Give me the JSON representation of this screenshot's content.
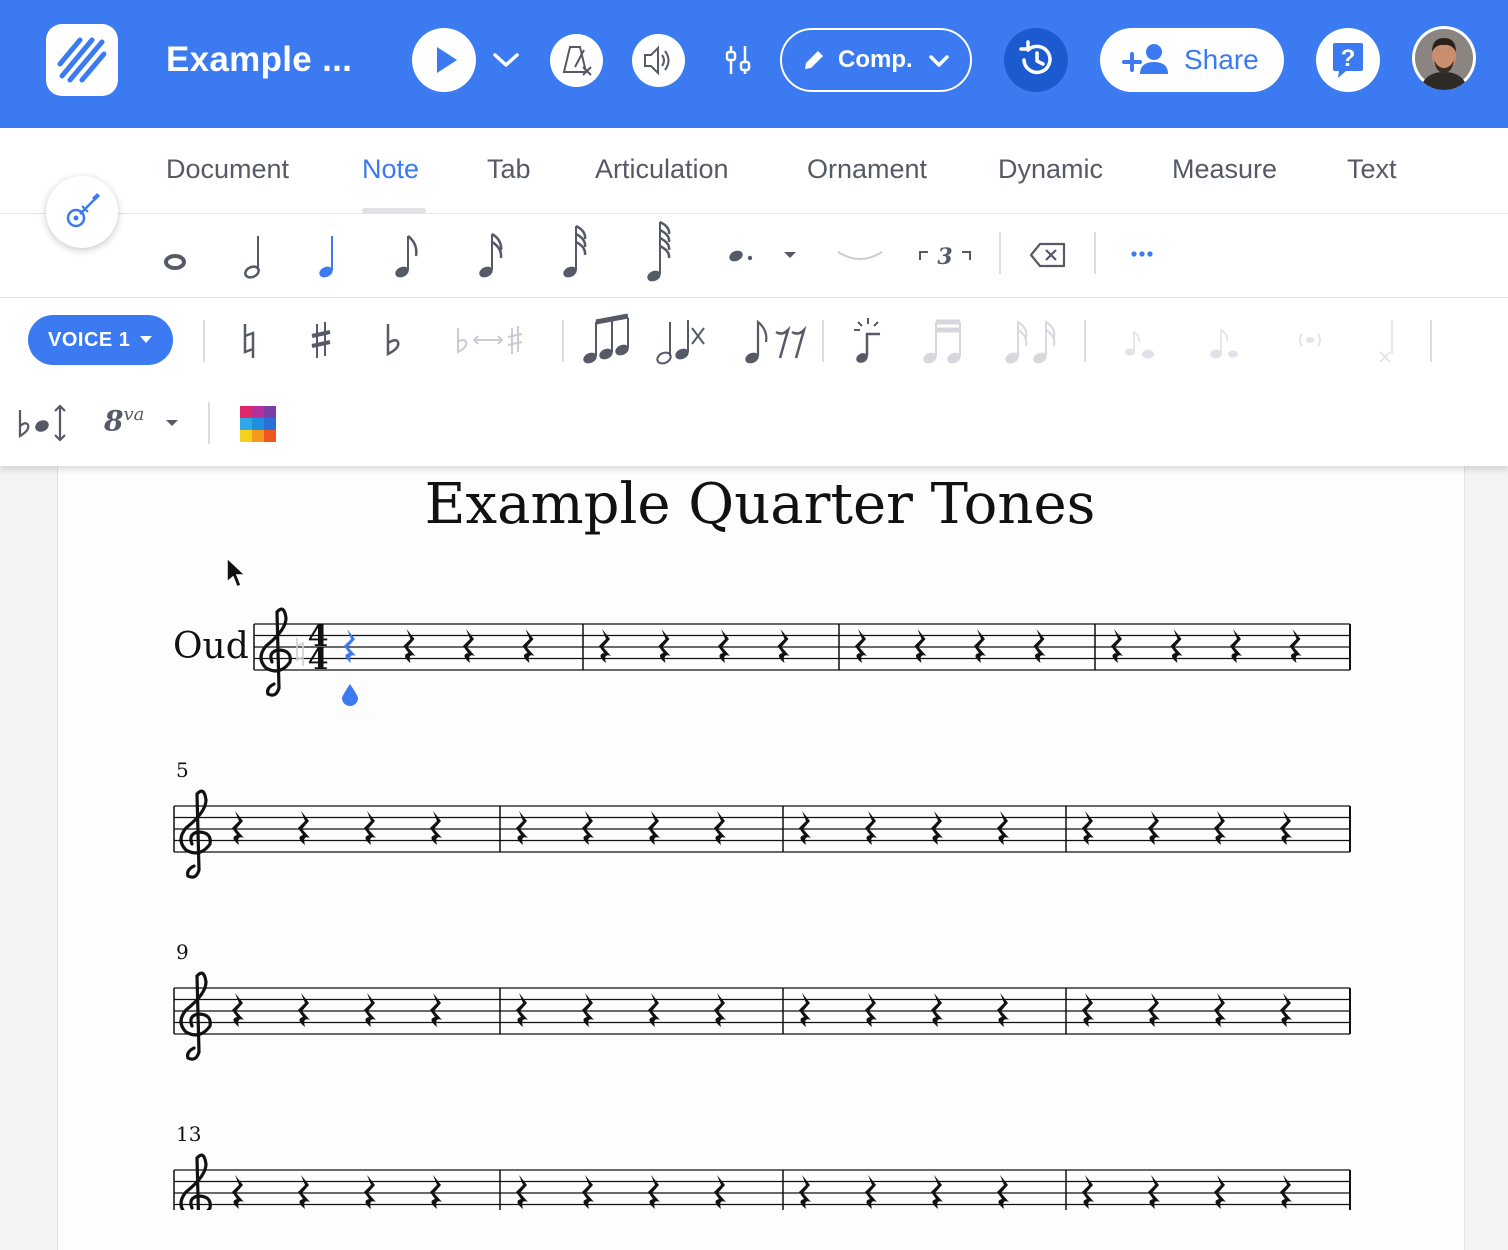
{
  "app": {
    "doc_title": "Example ...",
    "comp_label": "Comp.",
    "share_label": "Share"
  },
  "tabs": [
    {
      "label": "Document",
      "active": false
    },
    {
      "label": "Note",
      "active": true
    },
    {
      "label": "Tab",
      "active": false
    },
    {
      "label": "Articulation",
      "active": false
    },
    {
      "label": "Ornament",
      "active": false
    },
    {
      "label": "Dynamic",
      "active": false
    },
    {
      "label": "Measure",
      "active": false
    },
    {
      "label": "Text",
      "active": false
    }
  ],
  "note_tools": {
    "durations": [
      "whole-note-icon",
      "half-note-icon",
      "quarter-note-icon",
      "eighth-note-icon",
      "sixteenth-note-icon",
      "thirty-second-note-icon",
      "sixty-fourth-note-icon"
    ],
    "selected_duration": "quarter-note-icon",
    "tuplet_label": "3"
  },
  "voice": {
    "label": "VOICE 1"
  },
  "ottava": {
    "main": "8",
    "sup": "va"
  },
  "colors": {
    "accent": "#3b7af0",
    "accent_dark": "#1c5bcf",
    "icon_gray": "#555a66",
    "disabled_gray": "#c9ccd4"
  },
  "score": {
    "title": "Example Quarter Tones",
    "instrument": "Oud",
    "time_signature": "4/4",
    "systems": [
      {
        "measure_number": "",
        "measures": 4
      },
      {
        "measure_number": "5",
        "measures": 4
      },
      {
        "measure_number": "9",
        "measures": 4
      },
      {
        "measure_number": "13",
        "measures": 4
      }
    ]
  }
}
